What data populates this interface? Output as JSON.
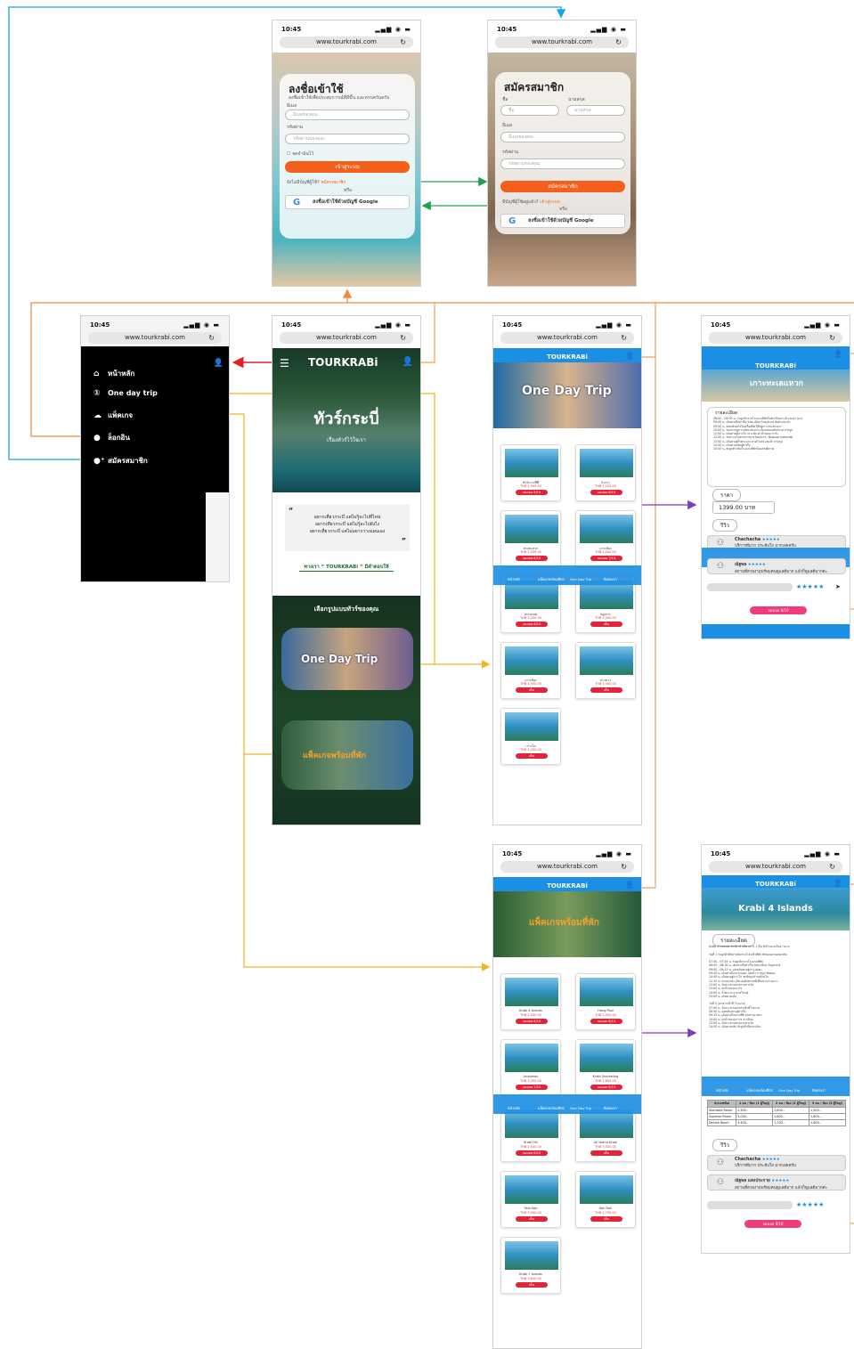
{
  "status": {
    "time": "10:45",
    "url": "www.tourkrabi.com"
  },
  "colors": {
    "cyan": "#1aa3d9",
    "orange": "#f08a3c",
    "amber": "#f0b323",
    "green": "#1fa34a",
    "red": "#e02020",
    "purple": "#7b3fb8",
    "blue": "#1b8fe3"
  },
  "login": {
    "title": "ลงชื่อเข้าใช้",
    "subtitle": "ลงชื่อเข้าใช้เพื่อประสบการณ์ที่ดีขึ้น และครบครันครับ",
    "email_label": "อีเมล",
    "email_placeholder": "อีเมลของคุณ",
    "password_label": "รหัสผ่าน",
    "password_placeholder": "รหัสผ่านของคุณ",
    "remember": "จดจำฉันไว้",
    "submit": "เข้าสู่ระบบ",
    "no_account": "ยังไม่มีบัญชีผู้ใช้?",
    "register_link": "สมัครสมาชิก",
    "or": "หรือ",
    "google": "ลงชื่อเข้าใช้ด้วยบัญชี Google"
  },
  "register": {
    "title": "สมัครสมาชิก",
    "first_label": "ชื่อ",
    "last_label": "นามสกุล",
    "first_placeholder": "ชื่อ",
    "last_placeholder": "นามสกุล",
    "email_label": "อีเมล",
    "email_placeholder": "อีเมลของคุณ",
    "password_label": "รหัสผ่าน",
    "password_placeholder": "รหัสผ่านของคุณ",
    "submit": "สมัครสมาชิก",
    "have_account": "มีบัญชีผู้ใช้อยู่แล้ว?",
    "login_link": "เข้าสู่ระบบ",
    "or": "หรือ",
    "google": "ลงชื่อเข้าใช้ด้วยบัญชี Google"
  },
  "menu": {
    "items": [
      {
        "icon": "home-icon",
        "label": "หน้าหลัก"
      },
      {
        "icon": "oneday-icon",
        "label": "One day trip"
      },
      {
        "icon": "package-icon",
        "label": "แพ็คเกจ"
      },
      {
        "icon": "user-icon",
        "label": "ล็อกอิน"
      },
      {
        "icon": "user-plus-icon",
        "label": "สมัครสมาชิก"
      }
    ]
  },
  "home": {
    "logo": "TOURKRABi",
    "hero_title": "ทัวร์กระบี่",
    "hero_sub": "เรื่องทัวร์ไว้ใจเรา",
    "quote_lines": [
      "อยากเที่ยวกระบี่ แต่ไม่รู้จะไปที่ไหน",
      "อยากเที่ยวกระบี่ แต่ไม่รู้จะไปยังไง",
      "อยากเที่ยวกระบี่ แต่ไม่อยากวางแผนเอง"
    ],
    "answer": "ทางเรา “ TOURKRABi ” มีคำตอบให้",
    "choose": "เลือกรูปแบบทัวร์ของคุณ",
    "card_oneday": "One Day Trip",
    "card_package": "แพ็คเกจพร้อมที่พัก"
  },
  "oneday": {
    "logo": "TOURKRABi",
    "banner": "One Day Trip",
    "items": [
      {
        "title": "ทัวร์เกาะพีพี",
        "price": "THB 1,399.00",
        "btn": "จองเลย 8/10"
      },
      {
        "title": "4 เกาะ",
        "price": "THB 1,100.00",
        "btn": "จองเลย 8/10"
      },
      {
        "title": "ทะเลแหวก",
        "price": "THB 1,399.00",
        "btn": "จองเลย 8/10"
      },
      {
        "title": "เกาะห้อง",
        "price": "THB 1,500.00",
        "btn": "จองเลย 7/10"
      },
      {
        "title": "สระมรกต",
        "price": "THB 1,200.00",
        "btn": "จองเลย 8/10"
      },
      {
        "title": "หมู่เกาะ",
        "price": "THB 1,000.00",
        "btn": "เต็ม"
      },
      {
        "title": "เกาะห้อง",
        "price": "THB 1,300.00",
        "btn": "เต็ม"
      },
      {
        "title": "อ่าวนาง",
        "price": "THB 1,000.00",
        "btn": "เต็ม"
      },
      {
        "title": "เกาะไผ่",
        "price": "THB 1,200.00",
        "btn": "เต็ม"
      }
    ]
  },
  "packages": {
    "logo": "TOURKRABi",
    "banner": "แพ็คเกจพร้อมที่พัก",
    "items": [
      {
        "title": "Krabi 4 Islands",
        "price": "THB 2,500.00",
        "btn": "จองเลย 8/10"
      },
      {
        "title": "Hong Pool",
        "price": "THB 2,500.00",
        "btn": "จองเลย 8/10"
      },
      {
        "title": "Andaman",
        "price": "THB 3,200.00",
        "btn": "จองเลย 7/10"
      },
      {
        "title": "Krabi Snorkeling",
        "price": "THB 2,800.00",
        "btn": "จองเลย 8/10"
      },
      {
        "title": "Krabi Hill",
        "price": "THB 2,500.00",
        "btn": "จองเลย 8/10"
      },
      {
        "title": "All Island Krabi",
        "price": "THB 3,500.00",
        "btn": "เต็ม"
      },
      {
        "title": "Twin Koh",
        "price": "THB 3,000.00",
        "btn": "เต็ม"
      },
      {
        "title": "Koh Rok",
        "price": "THB 2,700.00",
        "btn": "เต็ม"
      },
      {
        "title": "Krabi 7 Islands",
        "price": "THB 3,800.00",
        "btn": "เต็ม"
      }
    ]
  },
  "nav": {
    "home": "หน้าหลัก",
    "package": "แพ็คเกจพร้อมที่พัก",
    "oneday": "One Day Trip",
    "contact": "ติดต่อเรา"
  },
  "detail1": {
    "logo": "TOURKRABi",
    "banner": "เกาะทะเลแหวก",
    "section_detail": "รายละเอียด",
    "section_price": "ราคา",
    "price": "1399.00 บาท",
    "section_review": "รีวิว",
    "reviews": [
      {
        "name": "Chachacha",
        "stars": "★★★★★",
        "text": "บริการดีมาก ประทับใจ มากเลยครับ"
      },
      {
        "name": "ณัฐพล",
        "stars": "★★★★★",
        "text": "สถานที่สวยงามพร้อมคนดูแลดีมาก แล้วก็ดูแลดีมากค่ะ"
      }
    ],
    "stars_input": "★★★★★",
    "book": "จองเลย 8/10"
  },
  "detail2": {
    "logo": "TOURKRABi",
    "banner": "Krabi 4 Islands",
    "section_detail": "รายละเอียด",
    "table_head": [
      "ประเภทห้อง",
      "1 คน / ห้อง (1 ผู้ใหญ่)",
      "2 คน / ห้อง (2 ผู้ใหญ่)",
      "3 คน / ห้อง (3 ผู้ใหญ่)"
    ],
    "table_rows": [
      [
        "Standard Room",
        "2,500.-",
        "1,800.-",
        "1,500.-"
      ],
      [
        "Superior Room",
        "3,000.-",
        "1,600.-",
        "1,600.-"
      ],
      [
        "Deluxe Room",
        "3,400.-",
        "1,700.-",
        "1,800.-"
      ]
    ],
    "section_review": "รีวิว",
    "reviews": [
      {
        "name": "Chachacha",
        "stars": "★★★★★",
        "text": "บริการดีมาก ประทับใจ มากเลยครับ"
      },
      {
        "name": "ณัฐพล แสงประกาย",
        "stars": "★★★★★",
        "text": "สถานที่สวยงามพร้อมคนดูแลดีมาก แล้วก็ดูแลดีมากค่ะ"
      }
    ],
    "stars_input": "★★★★★",
    "book": "จองเลย 8/10"
  }
}
